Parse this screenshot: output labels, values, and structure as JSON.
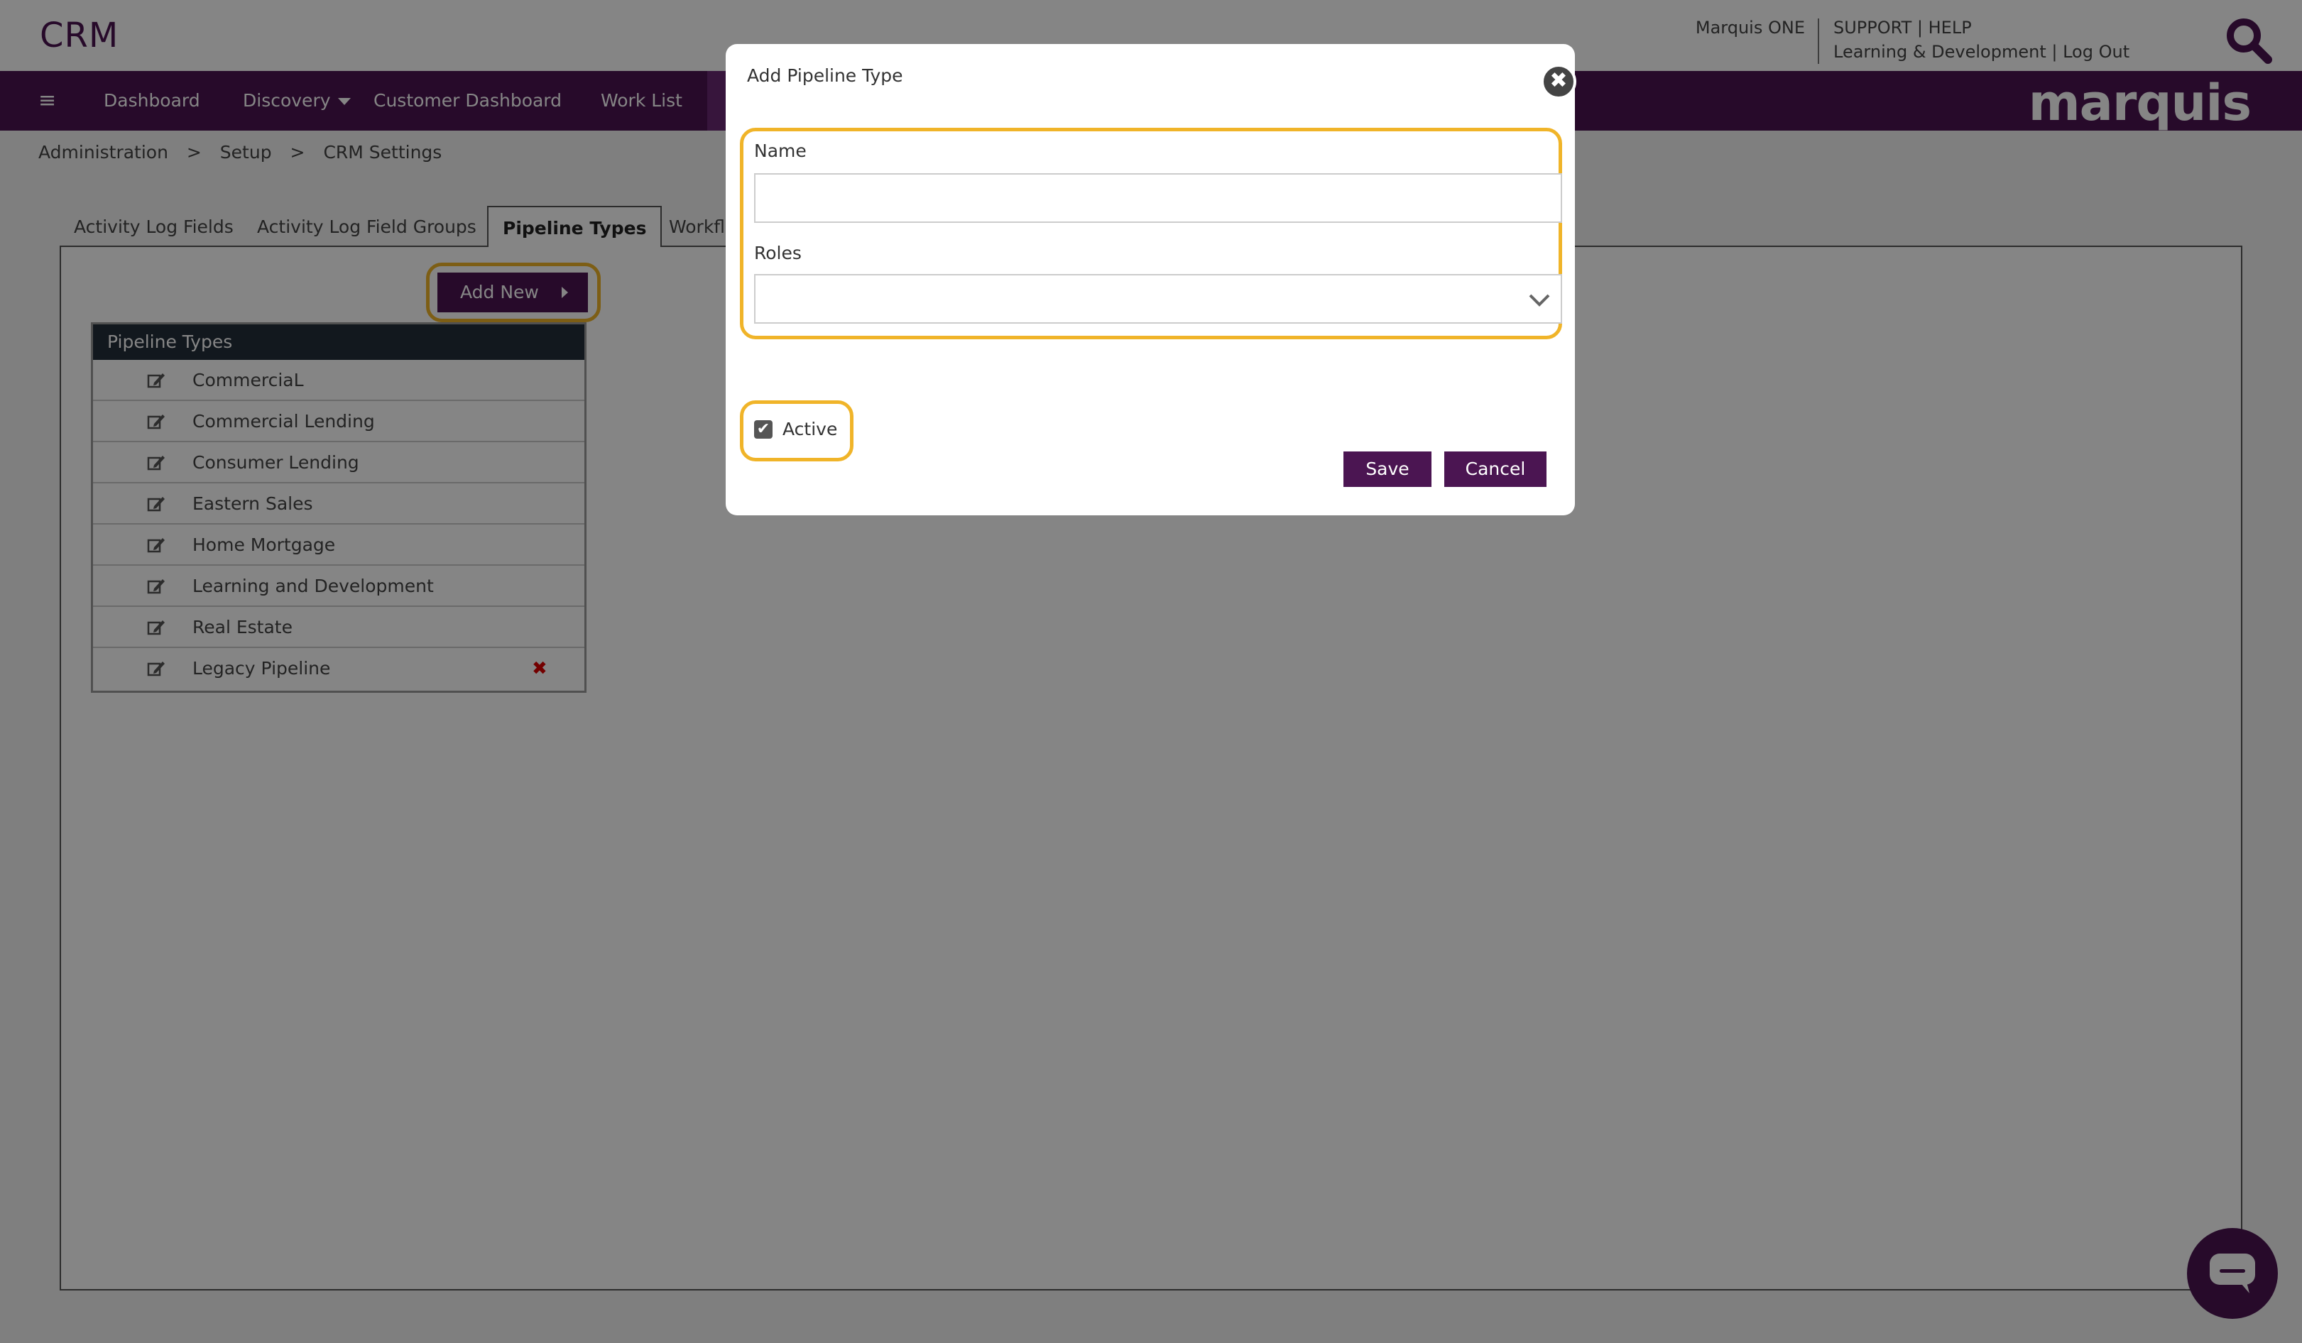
{
  "header": {
    "app_title": "CRM",
    "marquis_one": "Marquis ONE",
    "support": "SUPPORT",
    "help": "HELP",
    "learning": "Learning & Development",
    "logout": "Log Out",
    "search_icon": "search-icon",
    "sep": "|"
  },
  "nav": {
    "menu_icon": "hamburger-icon",
    "items": [
      {
        "label": "Dashboard"
      },
      {
        "label": "Discovery"
      },
      {
        "label": "Customer Dashboard"
      },
      {
        "label": "Work List"
      }
    ],
    "brand": "marquis"
  },
  "breadcrumb": {
    "items": [
      "Administration",
      "Setup",
      "CRM Settings"
    ],
    "separator": ">"
  },
  "tabs": [
    {
      "label": "Activity Log Fields"
    },
    {
      "label": "Activity Log Field Groups"
    },
    {
      "label": "Pipeline Types",
      "active": true
    },
    {
      "label": "Workfl"
    }
  ],
  "pipeline": {
    "add_new_label": "Add New",
    "table_header": "Pipeline Types",
    "rows": [
      {
        "label": "CommerciaL"
      },
      {
        "label": "Commercial Lending"
      },
      {
        "label": "Consumer Lending"
      },
      {
        "label": "Eastern Sales"
      },
      {
        "label": "Home Mortgage"
      },
      {
        "label": "Learning and Development"
      },
      {
        "label": "Real Estate"
      },
      {
        "label": "Legacy Pipeline",
        "deletable": true
      }
    ],
    "delete_glyph": "✖"
  },
  "modal": {
    "title": "Add Pipeline Type",
    "close_glyph": "✖",
    "name_label": "Name",
    "name_value": "",
    "roles_label": "Roles",
    "roles_value": "",
    "active_label": "Active",
    "active_checked": true,
    "check_glyph": "✔",
    "save_label": "Save",
    "cancel_label": "Cancel"
  },
  "colors": {
    "brand_purple": "#4b1552",
    "highlight": "#f0b429",
    "table_header": "#232f3a",
    "delete_red": "#d00000"
  }
}
